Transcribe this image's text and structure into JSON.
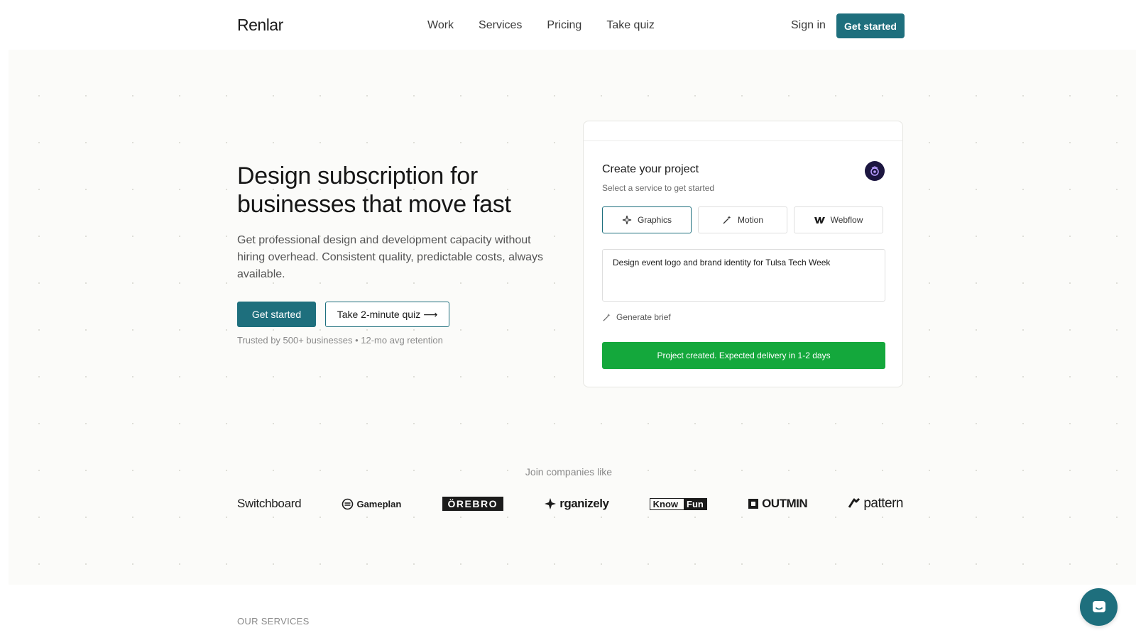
{
  "header": {
    "logo": "Renlar",
    "nav": [
      "Work",
      "Services",
      "Pricing",
      "Take quiz"
    ],
    "sign_in": "Sign in",
    "cta": "Get started"
  },
  "hero": {
    "headline": "Design subscription for businesses that move fast",
    "subcopy": "Get professional design and development capacity without hiring overhead. Consistent quality, predictable costs, always available.",
    "primary_button": "Get started",
    "quiz_button": "Take 2-minute quiz",
    "quiz_arrow": "⟶",
    "trusted": "Trusted by 500+ businesses • 12-mo avg retention"
  },
  "card": {
    "title": "Create your project",
    "subtitle": "Select a service to get started",
    "services": [
      {
        "label": "Graphics",
        "icon": "sparkle-icon",
        "selected": true
      },
      {
        "label": "Motion",
        "icon": "magic-wand-icon",
        "selected": false
      },
      {
        "label": "Webflow",
        "icon": "webflow-icon",
        "selected": false
      }
    ],
    "brief_value": "Design event logo and brand identity for Tulsa Tech Week",
    "generate_label": "Generate brief",
    "success_message": "Project created. Expected delivery in 1-2 days"
  },
  "companies": {
    "label": "Join companies like",
    "logos": [
      "Switchboard",
      "Gameplan",
      "ÖREBRO",
      "rganizely",
      "Know",
      "Fun",
      "OUTMIN",
      "pattern"
    ]
  },
  "services_section": {
    "label": "OUR SERVICES"
  },
  "colors": {
    "accent": "#1e6f7d",
    "success": "#14a83c",
    "text": "#1b1b1b",
    "muted": "#8a8a8a"
  }
}
